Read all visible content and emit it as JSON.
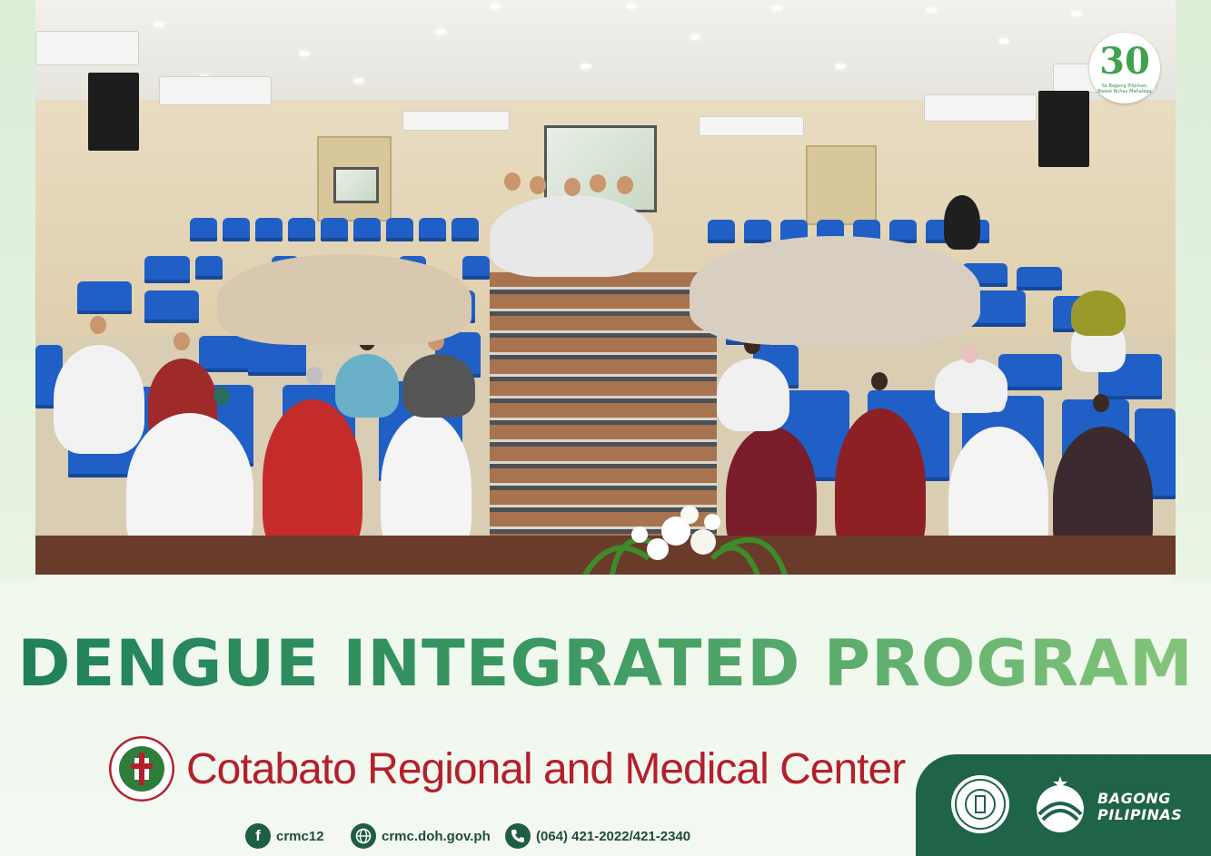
{
  "badge": {
    "number": "30",
    "tagline": "Sa Bagong Pilipinas, Bawat Buhay Mahalaga"
  },
  "title": "DENGUE INTEGRATED PROGRAM",
  "organization": {
    "name": "Cotabato Regional and Medical Center"
  },
  "contacts": [
    {
      "icon": "facebook-icon",
      "label": "crmc12"
    },
    {
      "icon": "globe-icon",
      "label": "crmc.doh.gov.ph"
    },
    {
      "icon": "phone-icon",
      "label": "(064) 421-2022/421-2340"
    }
  ],
  "branding": {
    "seal_name": "department-of-health-seal",
    "slogan_line1": "BAGONG",
    "slogan_line2": "PILIPINAS"
  },
  "colors": {
    "title_start": "#1f7f58",
    "title_end": "#86c67b",
    "org_red": "#b41f2c",
    "panel_green": "#1f6348",
    "seat_blue": "#1f5fc6"
  }
}
